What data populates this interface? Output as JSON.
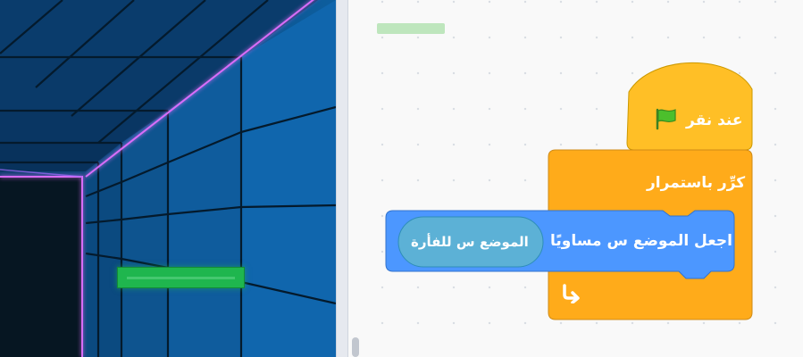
{
  "code": {
    "hat_block_label": "عند نقر",
    "hat_flag_icon": "green-flag-icon",
    "forever_label": "كرِّر باستمرار",
    "loop_arrow_icon": "loop-arrow-icon",
    "motion_label": "اجعل الموضع س مساويًا",
    "reporter_label": "الموضع س للفأرة"
  },
  "colors": {
    "events": "#ffbf26",
    "control": "#ffab1a",
    "motion": "#4c97ff",
    "sensing": "#5cb1d6",
    "paddle": "#1db34a"
  }
}
